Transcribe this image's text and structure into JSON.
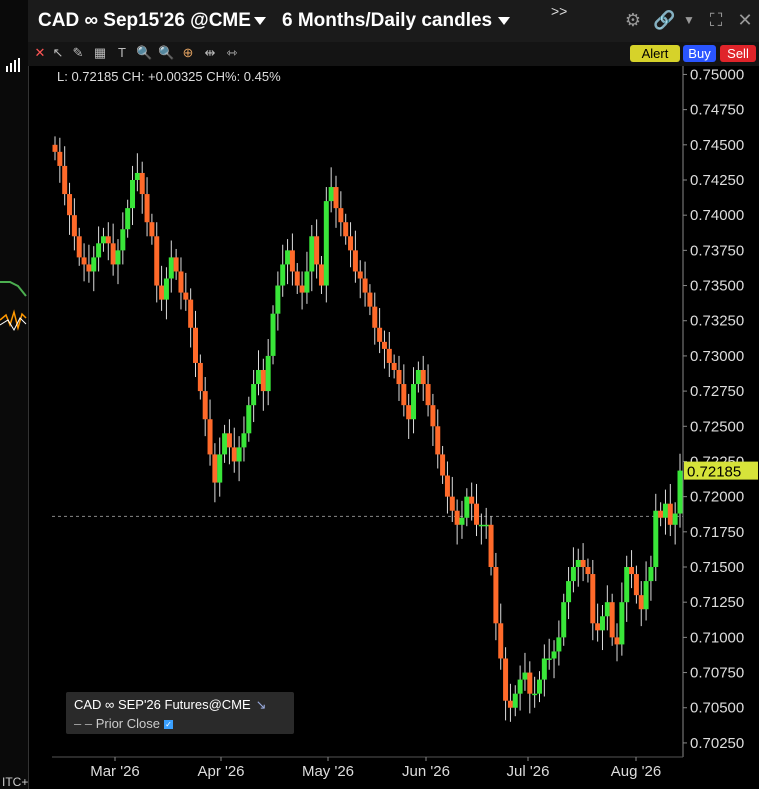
{
  "window": {
    "instrument": "CAD ∞ Sep15'26 @CME",
    "period": "6 Months/Daily candles",
    "more": ">>"
  },
  "toolbar": {
    "alert_label": "Alert",
    "buy_label": "Buy",
    "sell_label": "Sell",
    "tools": [
      "close-icon",
      "cursor-icon",
      "draw-line-icon",
      "table-icon",
      "text-icon",
      "zoom-icon",
      "zoom-out-icon",
      "crosshair-icon",
      "pan-icon",
      "split-icon"
    ]
  },
  "ohlc_readout": "L: 0.72185 CH: +0.00325 CH%: 0.45%",
  "legend": {
    "series_label": "CAD ∞ SEP'26 Futures@CME",
    "prior_close_label": "Prior Close"
  },
  "left_strip": {
    "bottom_text": "ITC+"
  },
  "colors": {
    "up": "#39e639",
    "down": "#ff6a2a",
    "last_price_bg": "#d6e33a",
    "legend_accent": "#3aa0ff"
  },
  "chart_data": {
    "type": "candlestick",
    "xlabels": [
      "Mar '26",
      "Apr '26",
      "May '26",
      "Jun '26",
      "Jul '26",
      "Aug '26"
    ],
    "y_ticks": [
      "0.75000",
      "0.74750",
      "0.74500",
      "0.74250",
      "0.74000",
      "0.73750",
      "0.73500",
      "0.73250",
      "0.73000",
      "0.72750",
      "0.72500",
      "0.72250",
      "0.72000",
      "0.71750",
      "0.71500",
      "0.71250",
      "0.71000",
      "0.70750",
      "0.70500",
      "0.70250"
    ],
    "ylim": [
      0.7015,
      0.7506
    ],
    "last_price": "0.72185",
    "prior_close": 0.7186,
    "grid": false,
    "closes": [
      0.7445,
      0.7435,
      0.7415,
      0.74,
      0.7385,
      0.737,
      0.7365,
      0.736,
      0.737,
      0.738,
      0.7385,
      0.738,
      0.7365,
      0.7375,
      0.739,
      0.7405,
      0.7425,
      0.743,
      0.7415,
      0.7395,
      0.7385,
      0.735,
      0.734,
      0.7355,
      0.737,
      0.736,
      0.7345,
      0.734,
      0.732,
      0.7295,
      0.7275,
      0.7255,
      0.723,
      0.721,
      0.723,
      0.7245,
      0.7235,
      0.7225,
      0.7235,
      0.7245,
      0.7265,
      0.728,
      0.729,
      0.7275,
      0.73,
      0.733,
      0.735,
      0.7365,
      0.7375,
      0.736,
      0.735,
      0.7345,
      0.736,
      0.7385,
      0.7365,
      0.735,
      0.741,
      0.742,
      0.7405,
      0.7395,
      0.7385,
      0.7375,
      0.736,
      0.7355,
      0.7345,
      0.7335,
      0.732,
      0.731,
      0.7305,
      0.7295,
      0.729,
      0.728,
      0.7265,
      0.7255,
      0.728,
      0.729,
      0.728,
      0.7265,
      0.725,
      0.723,
      0.7215,
      0.72,
      0.719,
      0.718,
      0.7185,
      0.72,
      0.7195,
      0.718,
      0.718,
      0.718,
      0.715,
      0.711,
      0.7085,
      0.7055,
      0.705,
      0.706,
      0.707,
      0.7075,
      0.706,
      0.706,
      0.707,
      0.7085,
      0.7085,
      0.709,
      0.71,
      0.7125,
      0.714,
      0.715,
      0.7155,
      0.715,
      0.7145,
      0.711,
      0.7105,
      0.7115,
      0.7125,
      0.71,
      0.7095,
      0.7125,
      0.715,
      0.7145,
      0.713,
      0.712,
      0.714,
      0.715,
      0.719,
      0.7185,
      0.7195,
      0.718,
      0.7188,
      0.72185
    ],
    "date_axis_note": ""
  }
}
